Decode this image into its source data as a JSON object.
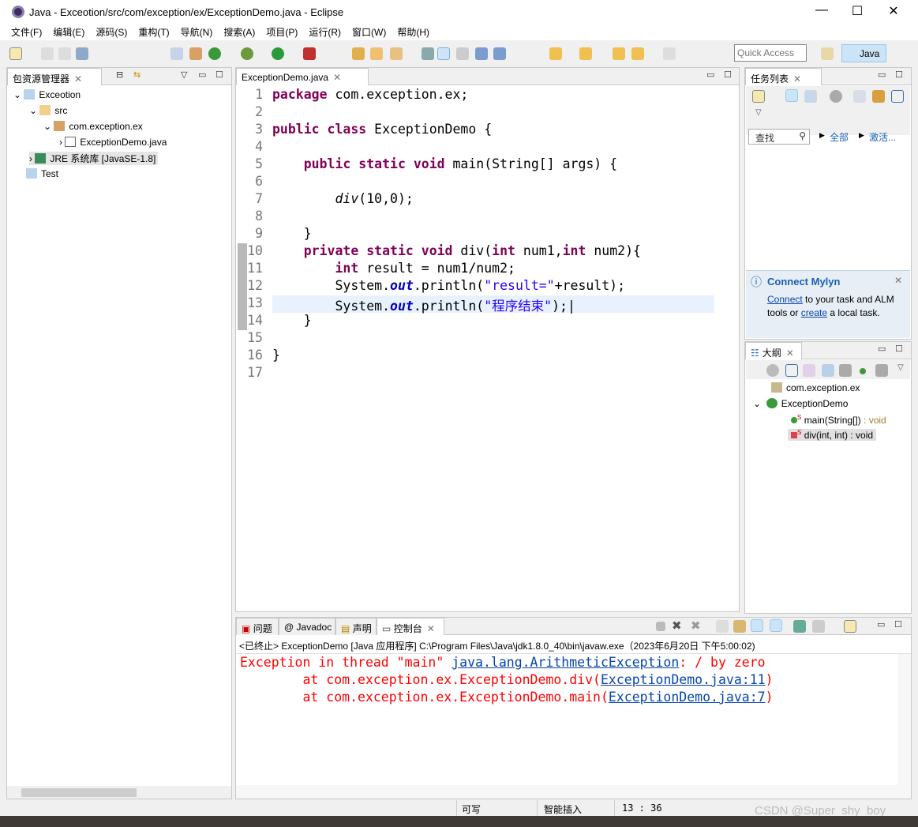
{
  "window": {
    "title": "Java - Exceotion/src/com/exception/ex/ExceptionDemo.java - Eclipse"
  },
  "menu": [
    "文件(F)",
    "编辑(E)",
    "源码(S)",
    "重构(T)",
    "导航(N)",
    "搜索(A)",
    "项目(P)",
    "运行(R)",
    "窗口(W)",
    "帮助(H)"
  ],
  "toolbar": {
    "quick_access_placeholder": "Quick Access",
    "perspective": "Java"
  },
  "package_explorer": {
    "tab": "包资源管理器",
    "tree": [
      {
        "label": "Exceotion",
        "level": 0,
        "expanded": true,
        "icon": "project-icon"
      },
      {
        "label": "src",
        "level": 1,
        "expanded": true,
        "icon": "source-folder-icon"
      },
      {
        "label": "com.exception.ex",
        "level": 2,
        "expanded": true,
        "icon": "package-icon"
      },
      {
        "label": "ExceptionDemo.java",
        "level": 3,
        "expanded": false,
        "icon": "java-file-icon"
      },
      {
        "label": "JRE 系统库 [JavaSE-1.8]",
        "level": 1,
        "expanded": false,
        "icon": "library-icon"
      },
      {
        "label": "Test",
        "level": 0,
        "icon": "project-icon"
      }
    ]
  },
  "editor": {
    "tab": "ExceptionDemo.java",
    "lines": [
      [
        [
          "kw",
          "package"
        ],
        [
          "",
          "com.exception.ex;"
        ]
      ],
      [],
      [
        [
          "kw",
          "public class"
        ],
        [
          "",
          "ExceptionDemo {"
        ]
      ],
      [],
      [
        [
          "",
          "    "
        ],
        [
          "kw",
          "public static void"
        ],
        [
          "",
          "main(String[] args) {"
        ]
      ],
      [],
      [
        [
          "",
          "        "
        ],
        [
          "it",
          "div"
        ],
        [
          "",
          "(10,0);"
        ]
      ],
      [],
      [
        [
          "",
          "    }"
        ]
      ],
      [
        [
          "",
          "    "
        ],
        [
          "kw",
          "private static void"
        ],
        [
          "",
          "div("
        ],
        [
          "kw",
          "int"
        ],
        [
          "",
          "num1,"
        ],
        [
          "kw",
          "int"
        ],
        [
          "",
          "num2){"
        ]
      ],
      [
        [
          "",
          "        "
        ],
        [
          "kw",
          "int"
        ],
        [
          "",
          "result = num1/num2;"
        ]
      ],
      [
        [
          "",
          "        System."
        ],
        [
          "fld",
          "out"
        ],
        [
          "",
          ".println("
        ],
        [
          "str",
          "\"result=\""
        ],
        [
          "",
          "+result);"
        ]
      ],
      [
        [
          "",
          "        System."
        ],
        [
          "fld",
          "out"
        ],
        [
          "",
          ".println("
        ],
        [
          "str",
          "\"程序结束\""
        ],
        [
          "",
          ");"
        ]
      ],
      [
        [
          "",
          "    }"
        ]
      ],
      [],
      [
        [
          "",
          "}"
        ]
      ],
      []
    ]
  },
  "tasks": {
    "tab": "任务列表",
    "find_placeholder": "查找",
    "all": "全部",
    "activate": "激活..."
  },
  "mylyn": {
    "title": "Connect Mylyn",
    "connect": "Connect",
    "text1": " to your task and ALM tools or ",
    "create": "create",
    "text2": " a local task."
  },
  "outline": {
    "tab": "大纲",
    "items": [
      {
        "label": "com.exception.ex"
      },
      {
        "label": "ExceptionDemo"
      },
      {
        "label": "main(String[])",
        "type": " : void"
      },
      {
        "label": "div(int, int) : void",
        "type": ""
      }
    ]
  },
  "console": {
    "tabs": [
      "问题",
      "Javadoc",
      "声明",
      "控制台"
    ],
    "header": "<已终止> ExceptionDemo [Java 应用程序] C:\\Program Files\\Java\\jdk1.8.0_40\\bin\\javaw.exe（2023年6月20日 下午5:00:02)",
    "l1a": "Exception in thread \"main\" ",
    "l1link": "java.lang.ArithmeticException",
    "l1b": ": / by zero",
    "l2a": "        at com.exception.ex.ExceptionDemo.div(",
    "l2link": "ExceptionDemo.java:11",
    "l2b": ")",
    "l3a": "        at com.exception.ex.ExceptionDemo.main(",
    "l3link": "ExceptionDemo.java:7",
    "l3b": ")"
  },
  "status": {
    "writable": "可写",
    "insert": "智能插入",
    "position": "13 : 36",
    "watermark": "CSDN @Super_shy_boy"
  }
}
